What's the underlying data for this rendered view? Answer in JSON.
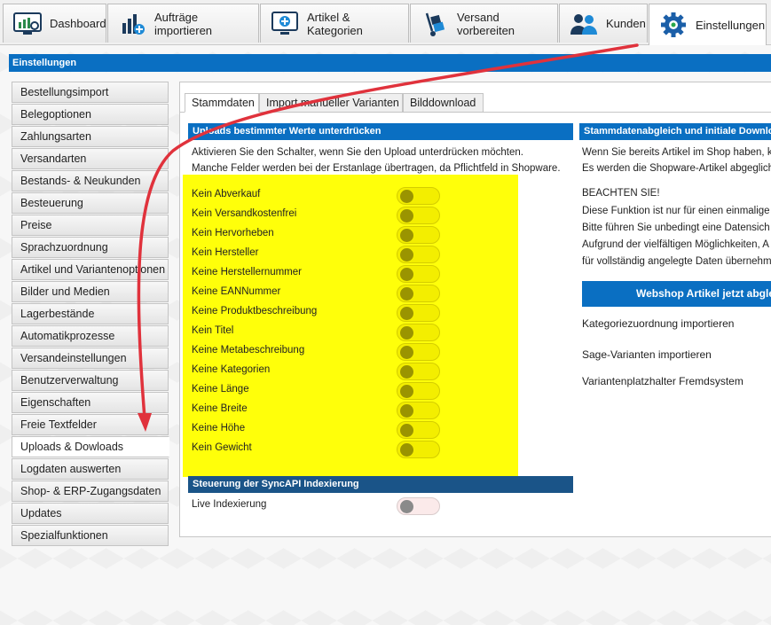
{
  "top_tabs": [
    {
      "label": "Dashboard",
      "icon": "dashboard-icon"
    },
    {
      "label": "Aufträge importieren",
      "icon": "import-orders-icon"
    },
    {
      "label": "Artikel & Kategorien",
      "icon": "articles-icon"
    },
    {
      "label": "Versand vorbereiten",
      "icon": "shipping-icon"
    },
    {
      "label": "Kunden",
      "icon": "customers-icon"
    },
    {
      "label": "Einstellungen",
      "icon": "gear-icon",
      "active": true
    }
  ],
  "title_bar": "Einstellungen",
  "sidebar": {
    "items": [
      "Bestellungsimport",
      "Belegoptionen",
      "Zahlungsarten",
      "Versandarten",
      "Bestands- & Neukunden",
      "Besteuerung",
      "Preise",
      "Sprachzuordnung",
      "Artikel und Variantenoptionen",
      "Bilder und Medien",
      "Lagerbestände",
      "Automatikprozesse",
      "Versandeinstellungen",
      "Benutzerverwaltung",
      "Eigenschaften",
      "Freie Textfelder",
      "Uploads & Dowloads",
      "Logdaten auswerten",
      "Shop- & ERP-Zugangsdaten",
      "Updates",
      "Spezialfunktionen"
    ],
    "active": "Uploads & Dowloads"
  },
  "inner_tabs": [
    "Stammdaten",
    "Import manueller Varianten",
    "Bilddownload"
  ],
  "left_section": {
    "header": "Uploads bestimmter Werte unterdrücken",
    "intro_line1": "Aktivieren Sie den Schalter, wenn Sie den Upload unterdrücken möchten.",
    "intro_line2": "Manche Felder werden bei der Erstanlage übertragen, da Pflichtfeld in Shopware.",
    "toggles": [
      {
        "label": "Kein Abverkauf",
        "on": true
      },
      {
        "label": "Kein Versandkostenfrei",
        "on": true
      },
      {
        "label": "Kein Hervorheben",
        "on": true
      },
      {
        "label": "Kein Hersteller",
        "on": true
      },
      {
        "label": "Keine Herstellernummer",
        "on": true
      },
      {
        "label": "Keine EANNummer",
        "on": true
      },
      {
        "label": "Keine Produktbeschreibung",
        "on": true
      },
      {
        "label": "Kein Titel",
        "on": true
      },
      {
        "label": "Keine Metabeschreibung",
        "on": true
      },
      {
        "label": "Keine Kategorien",
        "on": true
      },
      {
        "label": "Keine Länge",
        "on": true
      },
      {
        "label": "Keine Breite",
        "on": true
      },
      {
        "label": "Keine Höhe",
        "on": true
      },
      {
        "label": "Kein Gewicht",
        "on": true
      }
    ]
  },
  "sync_section": {
    "header": "Steuerung der SyncAPI Indexierung",
    "label": "Live Indexierung",
    "on": false
  },
  "right_section": {
    "header": "Stammdatenabgleich und initiale Downlo",
    "line1": "Wenn Sie bereits Artikel im Shop haben, k",
    "line2": "Es werden die Shopware-Artikel abgeglich",
    "note_title": "BEACHTEN SIE!",
    "note_line1": "Diese Funktion ist nur für einen einmalige",
    "note_line2": "Bitte führen Sie unbedingt eine Datensich",
    "note_line3": "Aufgrund der vielfältigen Möglichkeiten, A",
    "note_line4": "für vollständig angelegte Daten übernehm",
    "button": "Webshop Artikel jetzt abgleich",
    "links": [
      "Kategoriezuordnung importieren",
      "Sage-Varianten importieren",
      "Variantenplatzhalter Fremdsystem"
    ]
  },
  "colors": {
    "accent": "#0a6fc2",
    "highlight": "#ffff0a",
    "arrow": "#e0323c"
  }
}
